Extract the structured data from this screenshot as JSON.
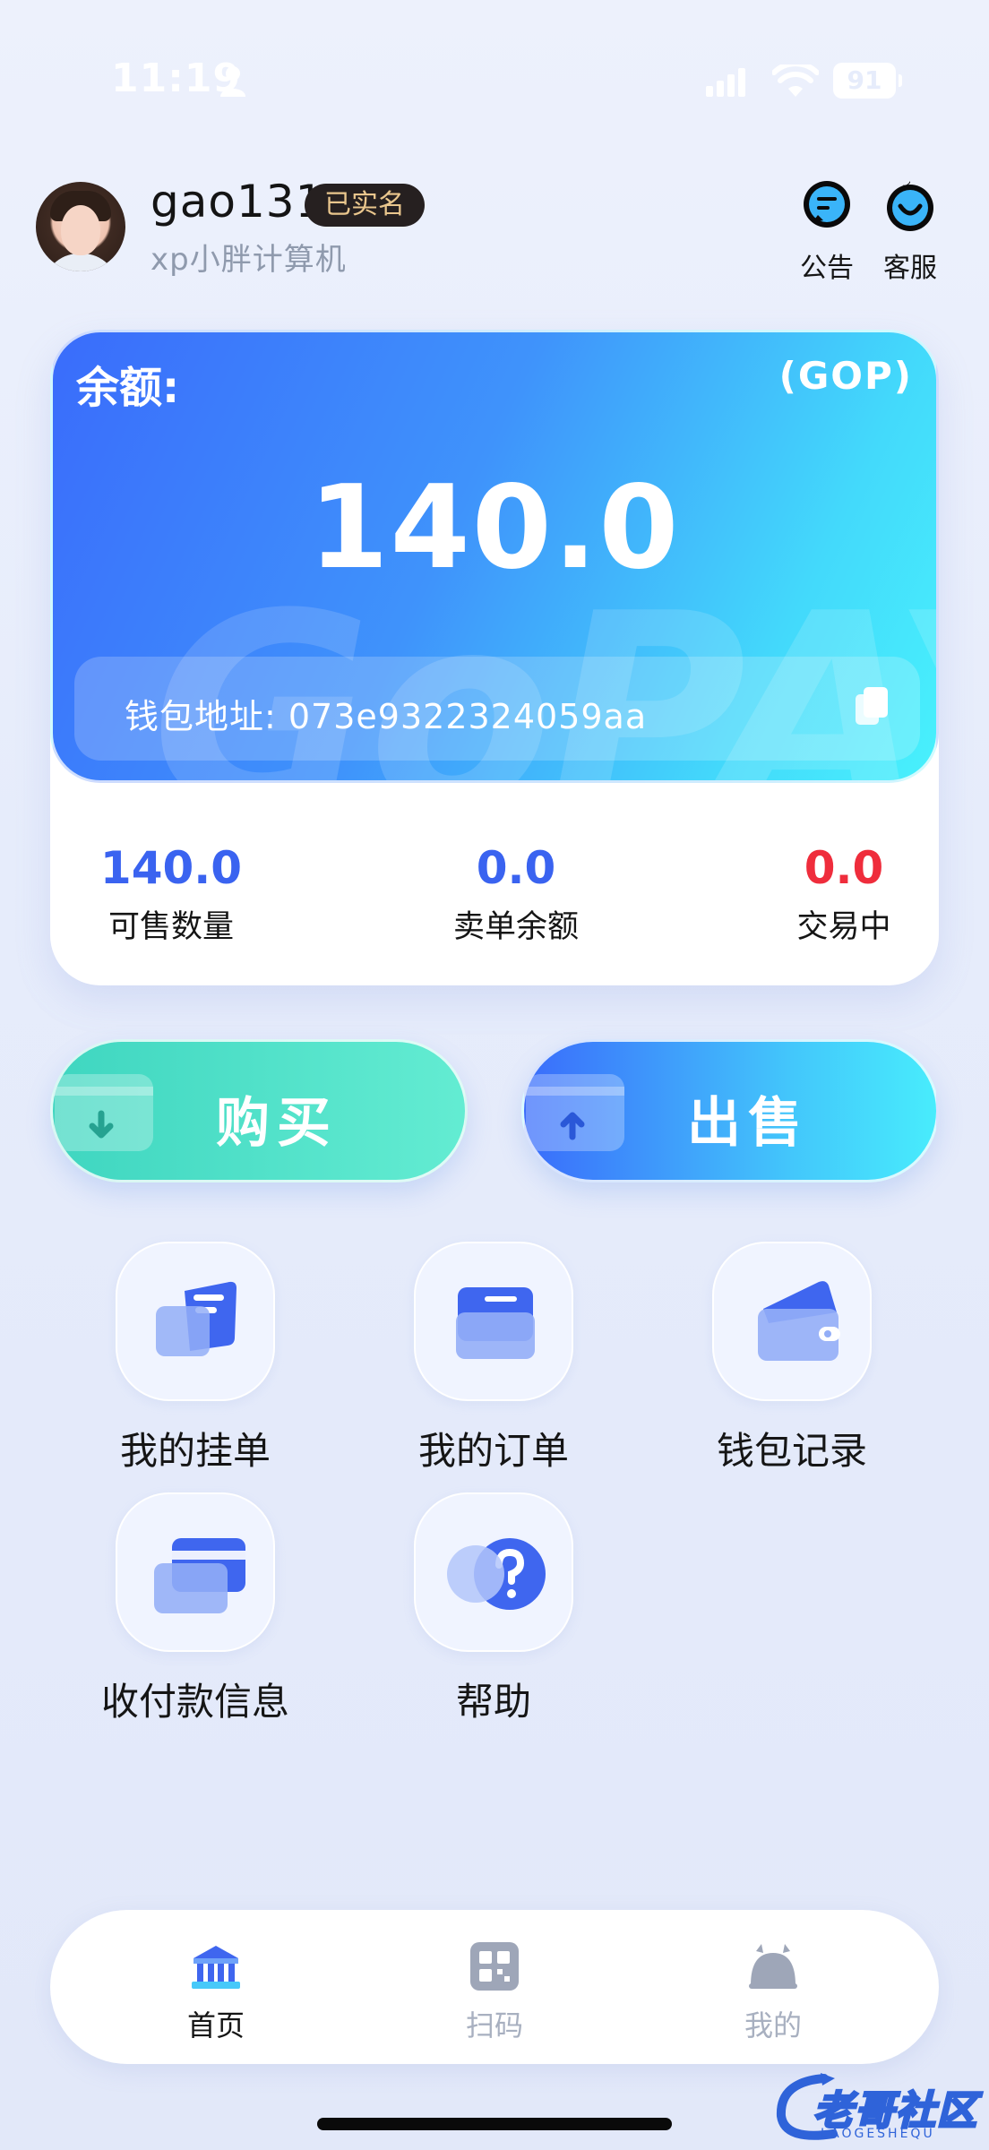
{
  "status_bar": {
    "time": "11:19",
    "battery": "91"
  },
  "header": {
    "username": "gao131",
    "verified_badge": "已实名",
    "subtitle": "xp小胖计算机",
    "actions": [
      {
        "label": "公告",
        "icon": "announcement-icon"
      },
      {
        "label": "客服",
        "icon": "customer-service-icon"
      }
    ]
  },
  "balance_card": {
    "label": "余额:",
    "currency": "(GOP)",
    "amount": "140.0",
    "watermark": "GoPAY",
    "wallet_address": "钱包地址: 073e932232405​9aa",
    "stats": [
      {
        "value": "140.0",
        "label": "可售数量",
        "color": "#3a63f0"
      },
      {
        "value": "0.0",
        "label": "卖单余额",
        "color": "#3a63f0"
      },
      {
        "value": "0.0",
        "label": "交易中",
        "color": "#ef2d3c"
      }
    ]
  },
  "trade": {
    "buy_label": "购买",
    "sell_label": "出售"
  },
  "menu": [
    {
      "label": "我的挂单",
      "icon": "ticket-icon"
    },
    {
      "label": "我的订单",
      "icon": "folder-icon"
    },
    {
      "label": "钱包记录",
      "icon": "wallet-icon"
    },
    {
      "label": "收付款信息",
      "icon": "card-icon"
    },
    {
      "label": "帮助",
      "icon": "help-icon"
    }
  ],
  "tab_bar": [
    {
      "label": "首页",
      "icon": "bank-icon",
      "active": true
    },
    {
      "label": "扫码",
      "icon": "qr-code-icon",
      "active": false
    },
    {
      "label": "我的",
      "icon": "profile-icon",
      "active": false
    }
  ],
  "corner_logo": {
    "text": "老哥社区",
    "sub": "LAOGESHEQU"
  },
  "colors": {
    "accent_blue": "#3a6cfb",
    "accent_cyan": "#48f1fc",
    "buy_green": "#3fd6c0",
    "negative_red": "#ef2d3c"
  }
}
